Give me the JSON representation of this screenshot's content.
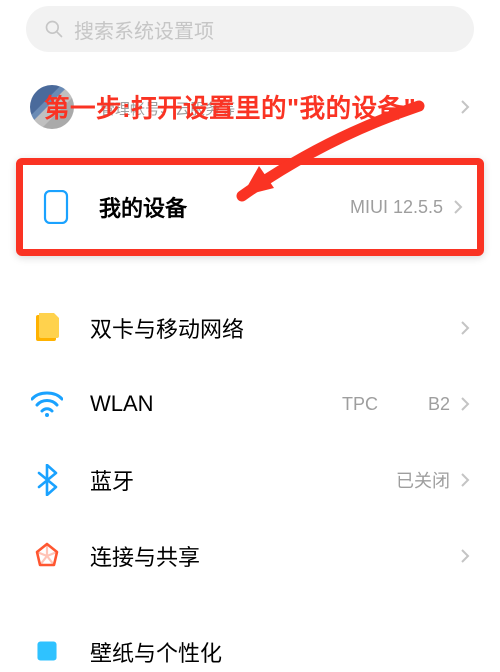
{
  "search": {
    "placeholder": "搜索系统设置项"
  },
  "annotation": {
    "text": "第一步:打开设置里的\"我的设备\""
  },
  "account": {
    "subtitle": "管理帐号、云服务等"
  },
  "device": {
    "label": "我的设备",
    "value": "MIUI 12.5.5"
  },
  "rows": [
    {
      "icon": "sim",
      "label": "双卡与移动网络",
      "value": ""
    },
    {
      "icon": "wifi",
      "label": "WLAN",
      "value": "TPC          B2"
    },
    {
      "icon": "bluetooth",
      "label": "蓝牙",
      "value": "已关闭"
    },
    {
      "icon": "share",
      "label": "连接与共享",
      "value": ""
    }
  ],
  "cutoff": {
    "label": "壁纸与个性化"
  },
  "colors": {
    "accent": "#fa3323"
  }
}
